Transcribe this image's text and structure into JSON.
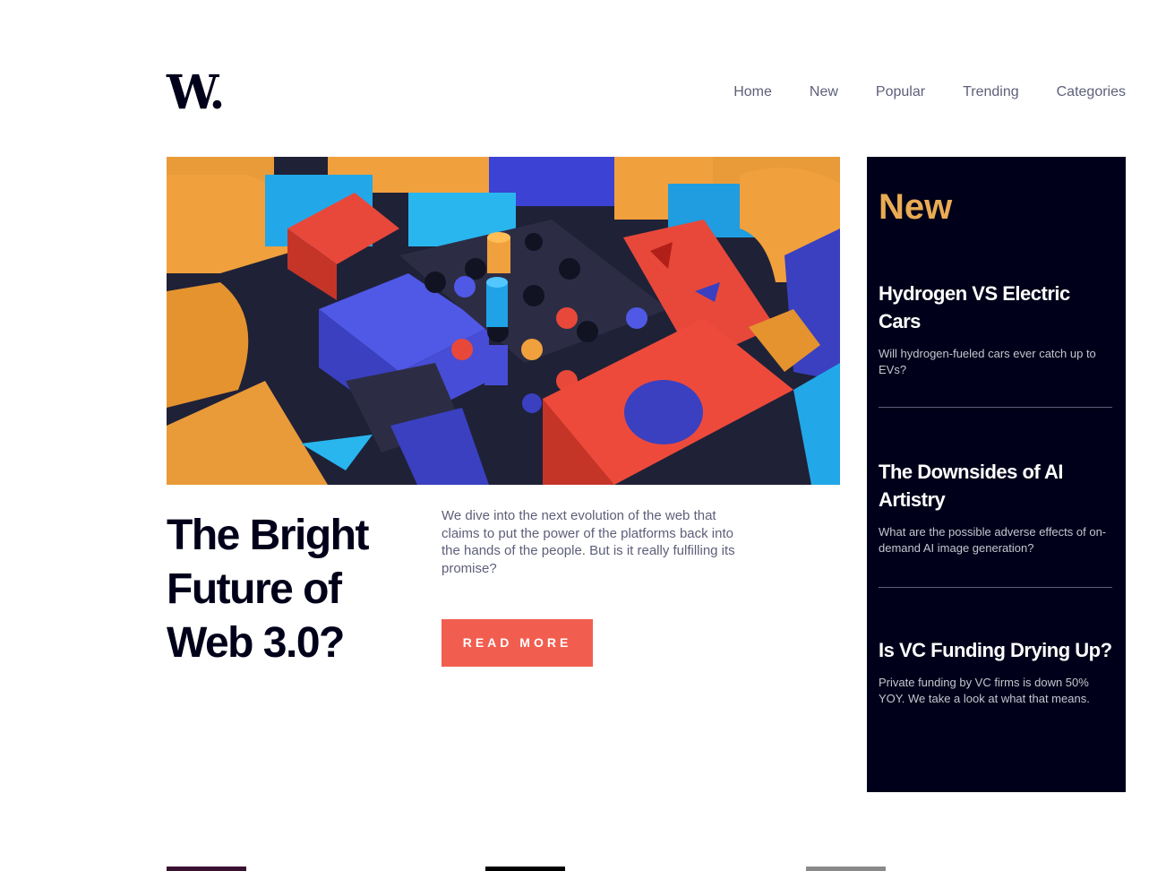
{
  "logo": {
    "text": "W",
    "dot": "."
  },
  "nav": [
    "Home",
    "New",
    "Popular",
    "Trending",
    "Categories"
  ],
  "hero": {
    "title": "The Bright Future of Web 3.0?",
    "description": "We dive into the next evolution of the web that claims to put the power of the platforms back into the hands of the people. But is it really fulfilling its promise?",
    "cta": "READ MORE"
  },
  "new_panel": {
    "title": "New",
    "items": [
      {
        "title": "Hydrogen VS Electric Cars",
        "desc": "Will hydrogen-fueled cars ever catch up to EVs?"
      },
      {
        "title": "The Downsides of AI Artistry",
        "desc": "What are the possible adverse effects of on-demand AI image generation?"
      },
      {
        "title": "Is VC Funding Drying Up?",
        "desc": "Private funding by VC firms is down 50% YOY. We take a look at what that means."
      }
    ]
  },
  "colors": {
    "navy": "#00001a",
    "orange": "#e9ab53",
    "red": "#f15e50",
    "grey_text": "#5d5f79"
  }
}
